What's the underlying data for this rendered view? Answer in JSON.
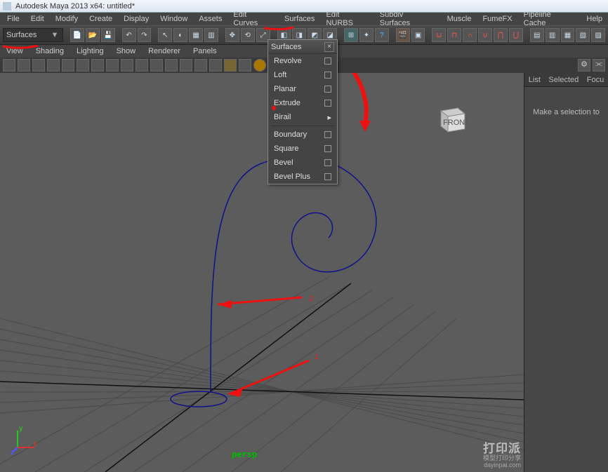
{
  "title": "Autodesk Maya 2013 x64: untitled*",
  "menu": [
    "File",
    "Edit",
    "Modify",
    "Create",
    "Display",
    "Window",
    "Assets",
    "Edit Curves",
    "Surfaces",
    "Edit NURBS",
    "Subdiv Surfaces",
    "Muscle",
    "FumeFX",
    "Pipeline Cache",
    "Help"
  ],
  "mode": "Surfaces",
  "panelmenu": [
    "View",
    "Shading",
    "Lighting",
    "Show",
    "Renderer",
    "Panels"
  ],
  "surfacesMenu": {
    "title": "Surfaces",
    "items": [
      {
        "label": "Revolve",
        "opt": true
      },
      {
        "label": "Loft",
        "opt": true
      },
      {
        "label": "Planar",
        "opt": true
      },
      {
        "label": "Extrude",
        "opt": true
      },
      {
        "label": "Birail",
        "sub": true
      },
      {
        "label": "__sep"
      },
      {
        "label": "Boundary",
        "opt": true
      },
      {
        "label": "Square",
        "opt": true
      },
      {
        "label": "Bevel",
        "opt": true
      },
      {
        "label": "Bevel Plus",
        "opt": true
      }
    ]
  },
  "rightPanel": {
    "tabs": [
      "List",
      "Selected",
      "Focu"
    ],
    "message": "Make a selection to"
  },
  "perspLabel": "persp",
  "viewcube": "FRONT",
  "watermark": {
    "big": "打印派",
    "small": "模型打印分享\ndayinpai.com"
  },
  "annotations": {
    "num1": "1",
    "num2": "2"
  }
}
